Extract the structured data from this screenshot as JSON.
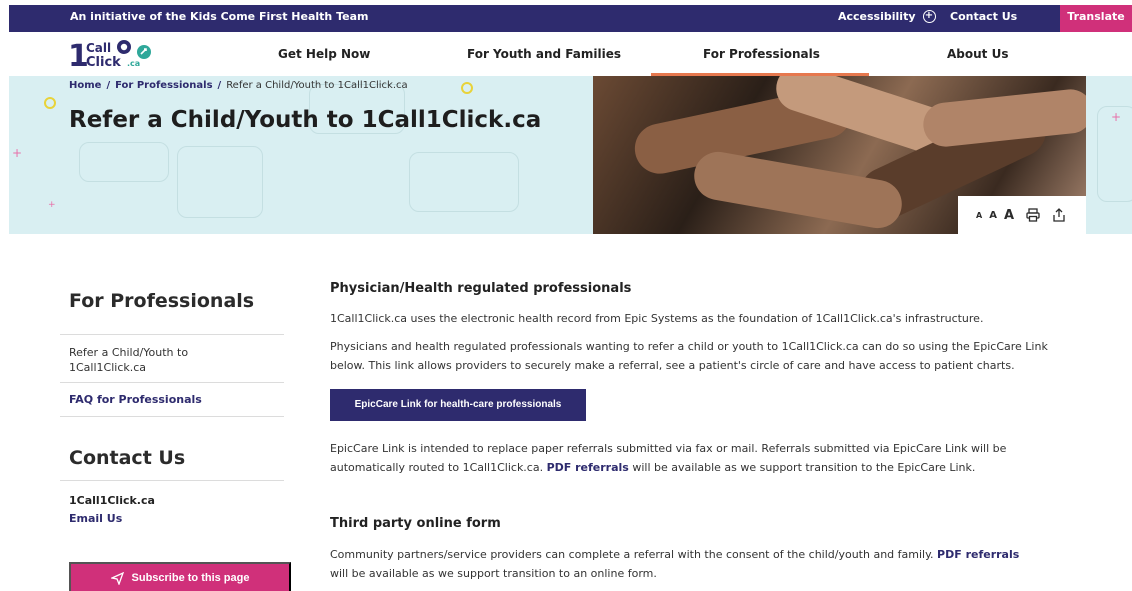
{
  "topbar": {
    "initiative": "An initiative of the Kids Come First Health Team",
    "accessibility": "Accessibility",
    "contact": "Contact Us",
    "translate": "Translate"
  },
  "brand": {
    "logo_line1": "Call",
    "logo_line2": "Click",
    "logo_num": "1",
    "logo_suffix": ".ca"
  },
  "nav": {
    "items": [
      {
        "label": "Get Help Now"
      },
      {
        "label": "For Youth and Families"
      },
      {
        "label": "For Professionals",
        "active": true
      },
      {
        "label": "About Us"
      }
    ]
  },
  "breadcrumb": {
    "home": "Home",
    "section": "For Professionals",
    "current": "Refer a Child/Youth to 1Call1Click.ca"
  },
  "hero": {
    "title": "Refer a Child/Youth to 1Call1Click.ca"
  },
  "textsize": {
    "small": "A",
    "medium": "A",
    "large": "A"
  },
  "sidebar": {
    "section_title": "For Professionals",
    "links": [
      {
        "label": "Refer a Child/Youth to 1Call1Click.ca",
        "current": true
      },
      {
        "label": "FAQ for Professionals"
      }
    ],
    "contact_title": "Contact Us",
    "contact_org": "1Call1Click.ca",
    "contact_email": "Email Us",
    "subscribe": "Subscribe to this page"
  },
  "main": {
    "section1_title": "Physician/Health regulated professionals",
    "p1": "1Call1Click.ca uses the electronic health record from Epic Systems as the foundation of 1Call1Click.ca's infrastructure.",
    "p2": "Physicians and health regulated professionals wanting to refer a child or youth to 1Call1Click.ca can do so using the EpicCare Link below. This link allows providers to securely make a referral, see a patient's circle of care and have access to patient charts.",
    "epic_button": "EpicCare Link for health-care professionals",
    "p3_before": "EpicCare Link is intended to replace paper referrals submitted via fax or mail. Referrals submitted via EpicCare Link will be automatically routed to 1Call1Click.ca.",
    "p3_link": "PDF referrals",
    "p3_after": "will be available as we support transition to the EpicCare Link.",
    "section2_title": "Third party online form",
    "p4_before": "Community partners/service providers can complete a referral with the consent of the child/youth and family.",
    "p4_link": "PDF referrals",
    "p4_after": "will be available as we support transition to an online form."
  },
  "colors": {
    "navy": "#2e2b6e",
    "pink": "#d0307a",
    "accent": "#e6784e",
    "hero_bg": "#d9eff2"
  }
}
